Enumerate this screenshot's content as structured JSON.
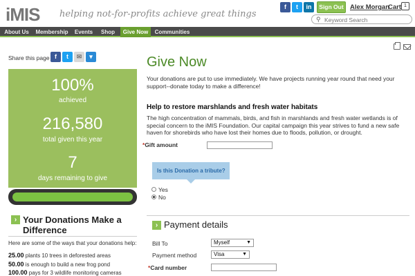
{
  "header": {
    "logo": "iMIS",
    "tagline": "helping not-for-profits achieve great things",
    "social": [
      {
        "icon": "facebook-icon",
        "glyph": "f",
        "color": "#3b5998"
      },
      {
        "icon": "twitter-icon",
        "glyph": "t",
        "color": "#1da1f2"
      },
      {
        "icon": "linkedin-icon",
        "glyph": "in",
        "color": "#0e76a8"
      }
    ],
    "sign_out": "Sign Out",
    "user": "Alex Morgan",
    "cart": "Cart",
    "cart_count": "1",
    "search_placeholder": "Keyword Search"
  },
  "nav": {
    "items": [
      {
        "label": "About Us",
        "active": false
      },
      {
        "label": "Membership",
        "active": false
      },
      {
        "label": "Events",
        "active": false
      },
      {
        "label": "Shop",
        "active": false
      },
      {
        "label": "Give Now",
        "active": true
      },
      {
        "label": "Communities",
        "active": false
      }
    ]
  },
  "sidebar": {
    "share_label": "Share this page",
    "stats": [
      {
        "value": "100%",
        "label": "achieved"
      },
      {
        "value": "216,580",
        "label": "total given this year"
      },
      {
        "value": "7",
        "label": "days remaining to give"
      }
    ],
    "progress_fraction": 1.0,
    "difference_heading": "Your Donations Make a Difference",
    "difference_intro": "Here are some of the ways that your donations help:",
    "impacts": [
      {
        "amount": "25.00",
        "text": "plants 10 trees in deforested areas"
      },
      {
        "amount": "50.00",
        "text": "is enough to build a new frog pond"
      },
      {
        "amount": "100.00",
        "text": "pays for 3 wildlife monitoring cameras"
      }
    ]
  },
  "main": {
    "title": "Give Now",
    "intro": "Your donations are put to use immediately. We have projects running year round that need your support--donate today to make a difference!",
    "campaign_heading": "Help to restore marshlands and fresh water habitats",
    "campaign_desc": "The high concentration of mammals, birds, and fish in marshlands and fresh water wetlands is of special concern to the iMIS Foundation. Our capital campaign this year strives to fund a new safe haven for shorebirds who have lost their homes due to floods, pollution, or drought.",
    "gift_label": "Gift amount",
    "gift_value": "",
    "tribute_question": "Is this Donation a tribute?",
    "tribute_options": [
      {
        "label": "Yes",
        "checked": false
      },
      {
        "label": "No",
        "checked": true
      }
    ],
    "payment_heading": "Payment details",
    "bill_to_label": "Bill To",
    "bill_to_value": "Myself",
    "payment_method_label": "Payment method",
    "payment_method_value": "Visa",
    "card_number_label": "Card number",
    "card_number_value": ""
  },
  "colors": {
    "brand_green": "#8cc152",
    "stats_bg": "#9bbf5e",
    "title_green": "#4c8a27",
    "nav_bg": "#4a4a4a"
  }
}
